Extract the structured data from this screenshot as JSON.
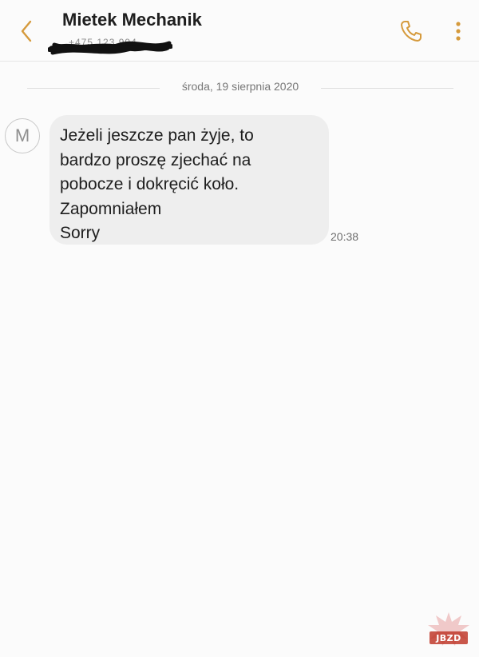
{
  "header": {
    "contact_name": "Mietek Mechanik",
    "contact_number": "+475 123 994",
    "back_icon": "chevron-left-icon",
    "call_icon": "phone-icon",
    "more_icon": "more-vertical-icon",
    "accent_color": "#d59a3c"
  },
  "thread": {
    "date_separator": "środa, 19 sierpnia 2020",
    "messages": [
      {
        "sender_initial": "M",
        "lines": [
          "Jeżeli jeszcze pan żyje, to",
          "bardzo proszę zjechać na",
          "pobocze i dokręcić koło.",
          "Zapomniałem",
          "Sorry"
        ],
        "time": "20:38"
      }
    ]
  },
  "watermark": {
    "text": "JBZD",
    "color": "#c0392b"
  }
}
